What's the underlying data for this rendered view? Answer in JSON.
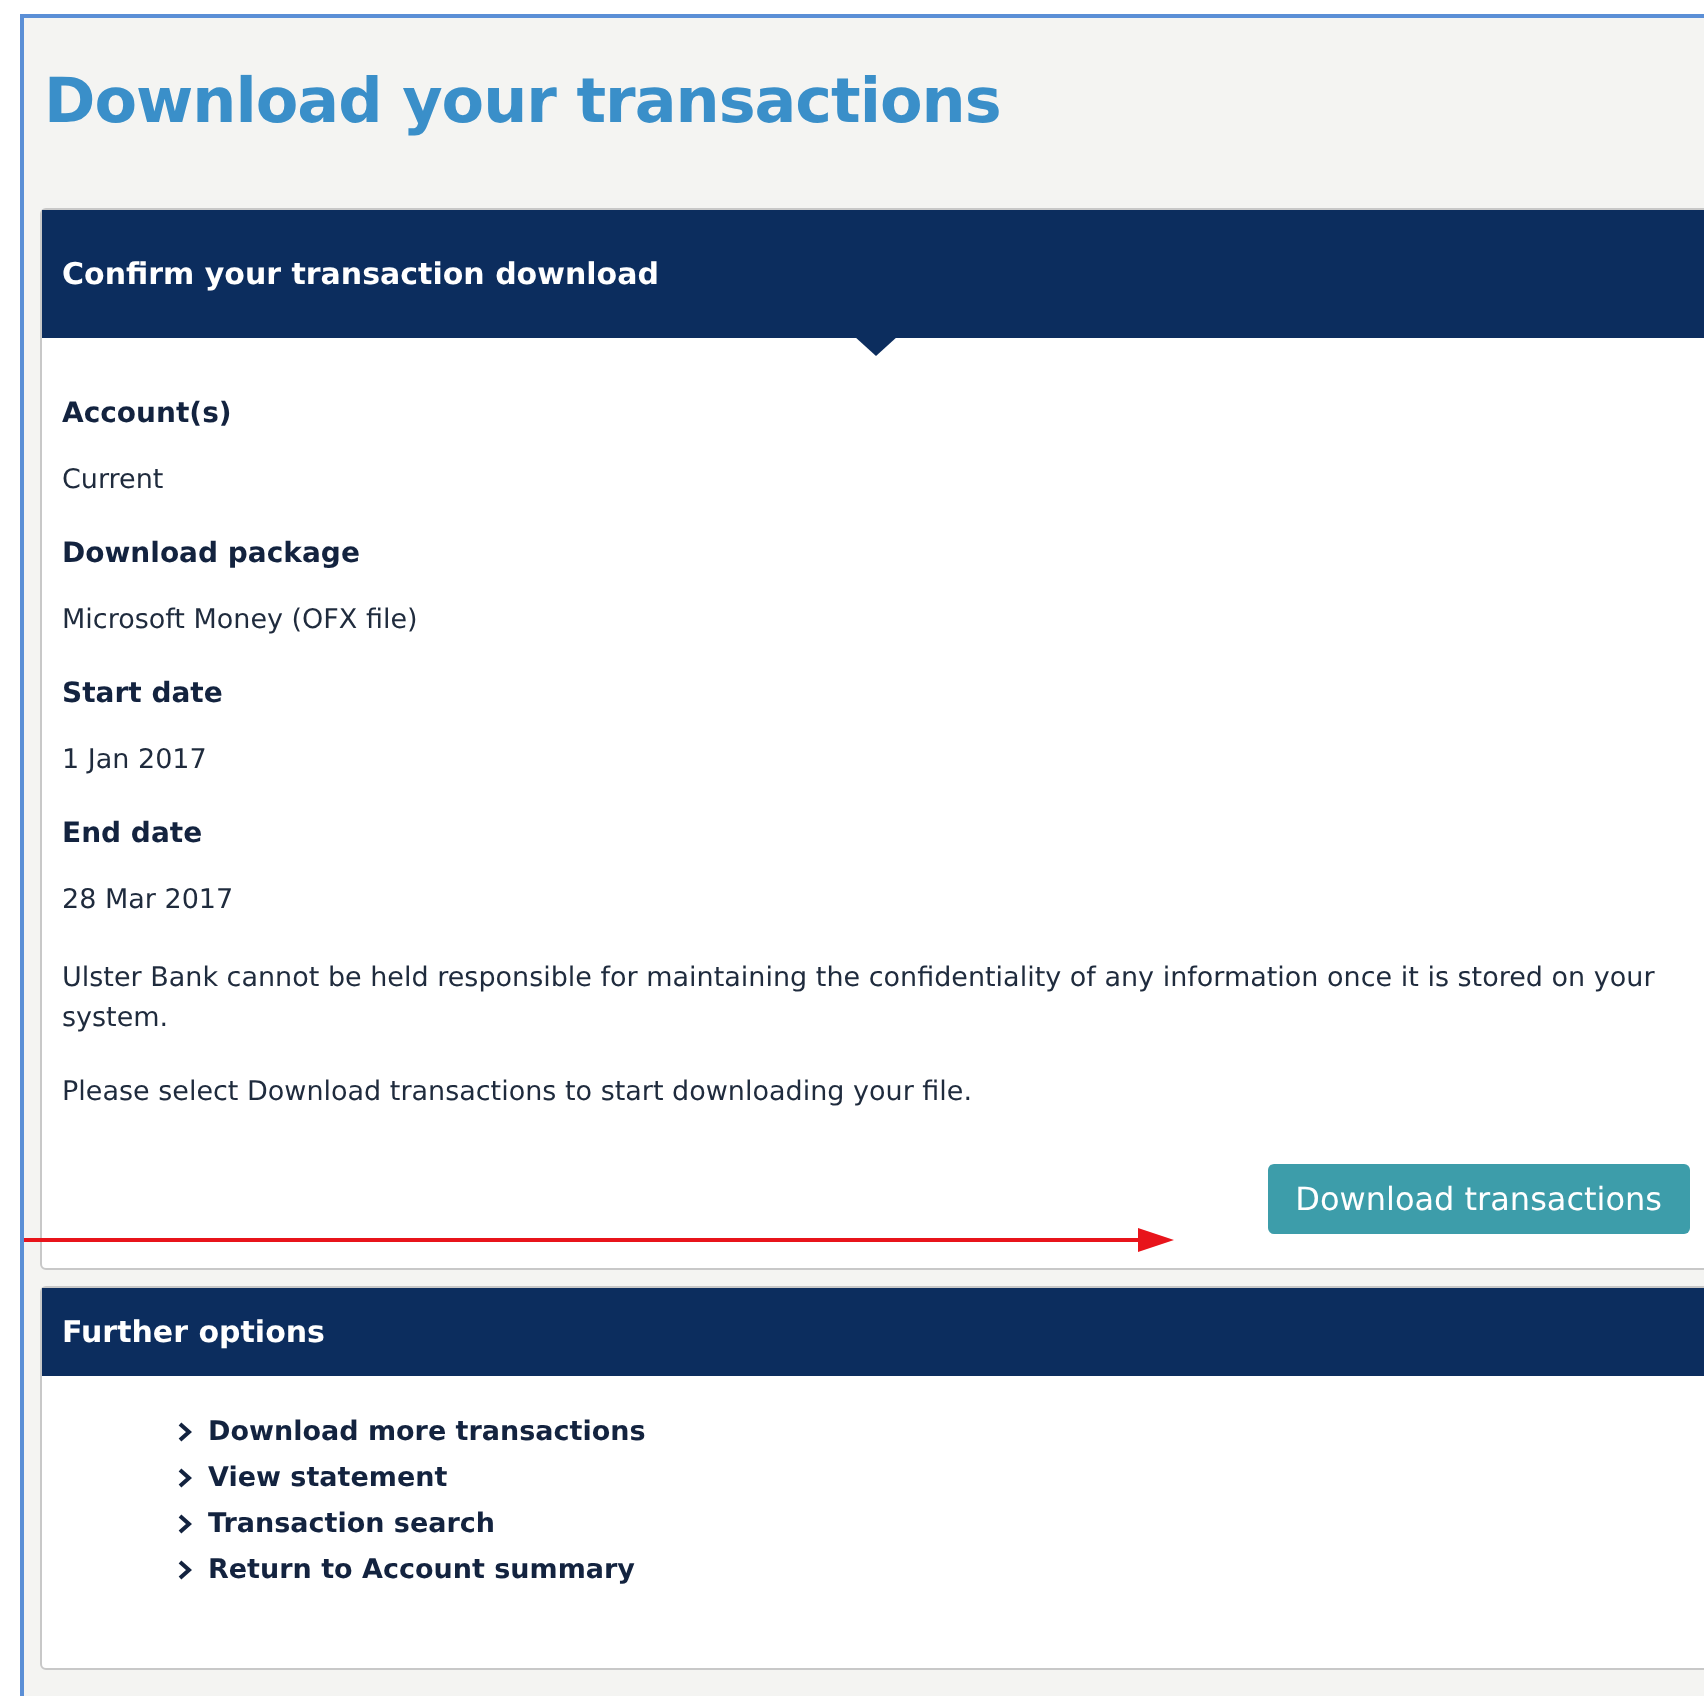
{
  "title": "Download your transactions",
  "confirm_panel": {
    "title": "Confirm your transaction download",
    "fields": [
      {
        "label": "Account(s)",
        "value": "Current"
      },
      {
        "label": "Download package",
        "value": "Microsoft Money (OFX file)"
      },
      {
        "label": "Start date",
        "value": "1 Jan 2017"
      },
      {
        "label": "End date",
        "value": "28 Mar 2017"
      }
    ],
    "notice": "Ulster Bank cannot be held responsible for maintaining the confidentiality of any information once it is stored on your system.",
    "instruction": "Please select Download transactions to start downloading your file.",
    "button": "Download transactions"
  },
  "further_options": {
    "title": "Further options",
    "links": [
      "Download more transactions",
      "View statement",
      "Transaction search",
      "Return to Account summary"
    ]
  }
}
